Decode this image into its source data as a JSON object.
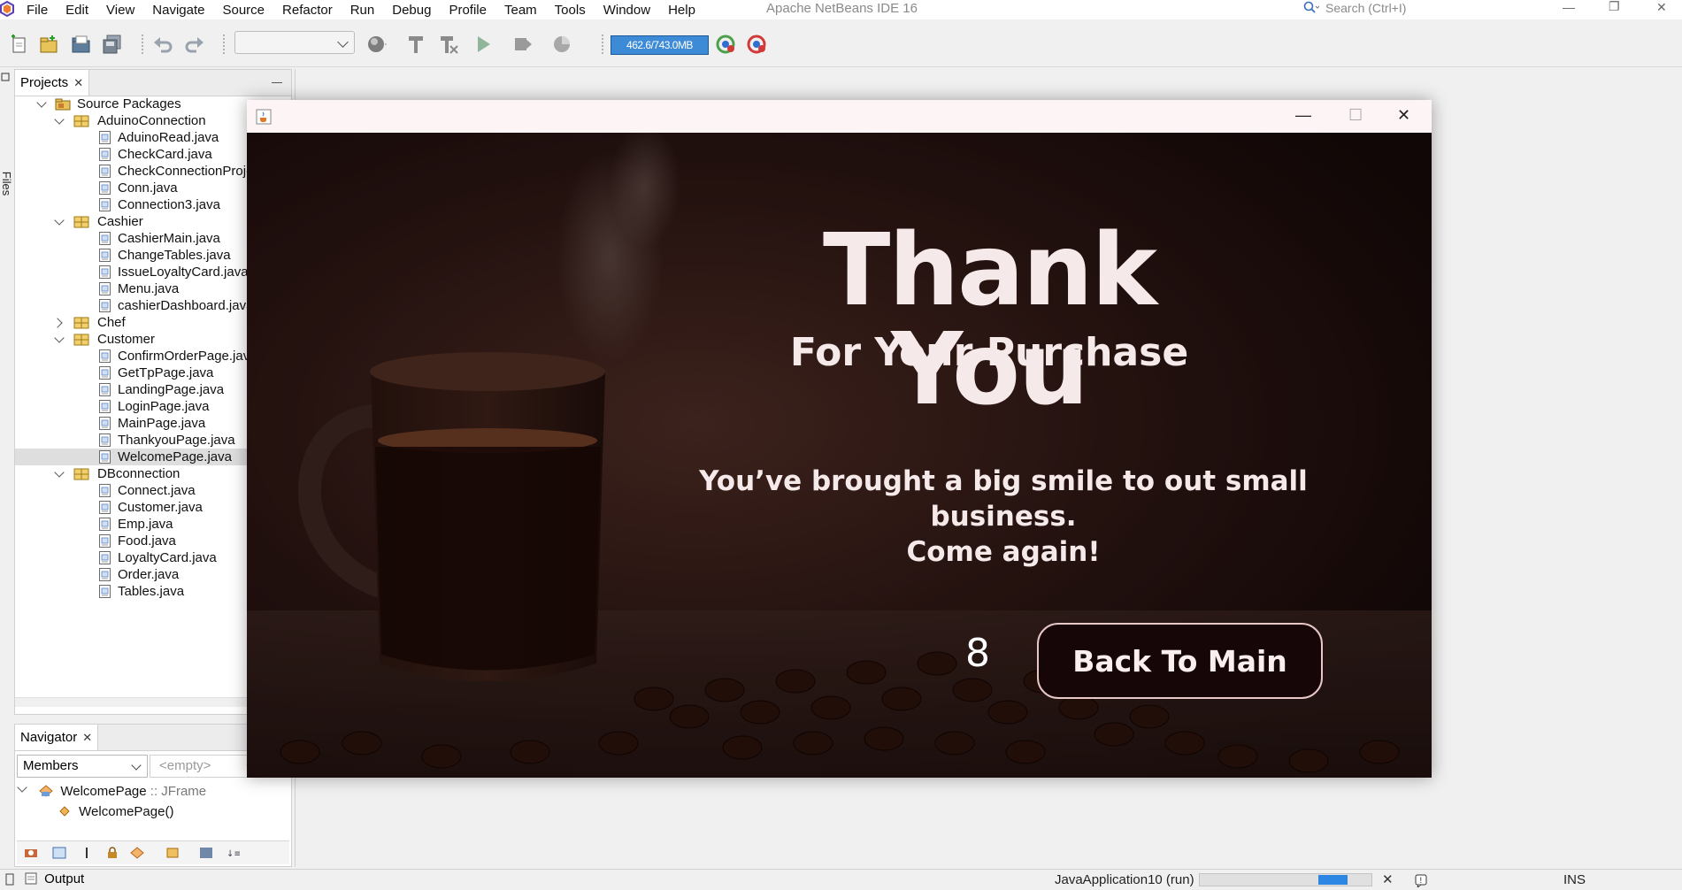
{
  "menubar": {
    "items": [
      "File",
      "Edit",
      "View",
      "Navigate",
      "Source",
      "Refactor",
      "Run",
      "Debug",
      "Profile",
      "Team",
      "Tools",
      "Window",
      "Help"
    ],
    "ide_title": "Apache NetBeans IDE 16",
    "search_placeholder": "Search (Ctrl+I)"
  },
  "toolbar": {
    "memory": "462.6/743.0MB"
  },
  "projects": {
    "tab_label": "Projects",
    "files_tab": "Files",
    "tree": [
      {
        "label": "Source Packages",
        "type": "root",
        "level": 0,
        "toggle": "open"
      },
      {
        "label": "AduinoConnection",
        "type": "package",
        "level": 1,
        "toggle": "open"
      },
      {
        "label": "AduinoRead.java",
        "type": "file",
        "level": 2
      },
      {
        "label": "CheckCard.java",
        "type": "file",
        "level": 2
      },
      {
        "label": "CheckConnectionProje",
        "type": "file",
        "level": 2
      },
      {
        "label": "Conn.java",
        "type": "file",
        "level": 2
      },
      {
        "label": "Connection3.java",
        "type": "file",
        "level": 2
      },
      {
        "label": "Cashier",
        "type": "package",
        "level": 1,
        "toggle": "open"
      },
      {
        "label": "CashierMain.java",
        "type": "file",
        "level": 2
      },
      {
        "label": "ChangeTables.java",
        "type": "file",
        "level": 2
      },
      {
        "label": "IssueLoyaltyCard.java",
        "type": "file",
        "level": 2
      },
      {
        "label": "Menu.java",
        "type": "file",
        "level": 2
      },
      {
        "label": "cashierDashboard.java",
        "type": "file",
        "level": 2
      },
      {
        "label": "Chef",
        "type": "package",
        "level": 1,
        "toggle": "closed"
      },
      {
        "label": "Customer",
        "type": "package",
        "level": 1,
        "toggle": "open"
      },
      {
        "label": "ConfirmOrderPage.jav",
        "type": "file",
        "level": 2
      },
      {
        "label": "GetTpPage.java",
        "type": "file",
        "level": 2
      },
      {
        "label": "LandingPage.java",
        "type": "file",
        "level": 2
      },
      {
        "label": "LoginPage.java",
        "type": "file",
        "level": 2
      },
      {
        "label": "MainPage.java",
        "type": "file",
        "level": 2
      },
      {
        "label": "ThankyouPage.java",
        "type": "file",
        "level": 2
      },
      {
        "label": "WelcomePage.java",
        "type": "file",
        "level": 2,
        "selected": true
      },
      {
        "label": "DBconnection",
        "type": "package",
        "level": 1,
        "toggle": "open"
      },
      {
        "label": "Connect.java",
        "type": "file",
        "level": 2
      },
      {
        "label": "Customer.java",
        "type": "file",
        "level": 2
      },
      {
        "label": "Emp.java",
        "type": "file",
        "level": 2
      },
      {
        "label": "Food.java",
        "type": "file",
        "level": 2
      },
      {
        "label": "LoyaltyCard.java",
        "type": "file",
        "level": 2
      },
      {
        "label": "Order.java",
        "type": "file",
        "level": 2
      },
      {
        "label": "Tables.java",
        "type": "file",
        "level": 2
      }
    ]
  },
  "navigator": {
    "tab_label": "Navigator",
    "filter_value": "Members",
    "second_filter": "<empty>",
    "class_name": "WelcomePage",
    "class_sep": " :: ",
    "class_type": "JFrame",
    "constructor": "WelcomePage()"
  },
  "statusbar": {
    "output_label": "Output",
    "run_label": "JavaApplication10 (run)",
    "progress_fraction": 0.17,
    "mode": "INS"
  },
  "dialog": {
    "title_main": "Thank You",
    "subtitle": "For Your Purchase",
    "message_line1": "You’ve brought a big smile to out small business.",
    "message_line2": "Come again!",
    "countdown": "8",
    "button_label": "Back To Main"
  },
  "colors": {
    "coffee_dark": "#1e0d0c",
    "text_light": "#f6e9ea",
    "button_bg": "#170607",
    "memory_bar": "#3d8bd6",
    "progress": "#2b87e3"
  }
}
